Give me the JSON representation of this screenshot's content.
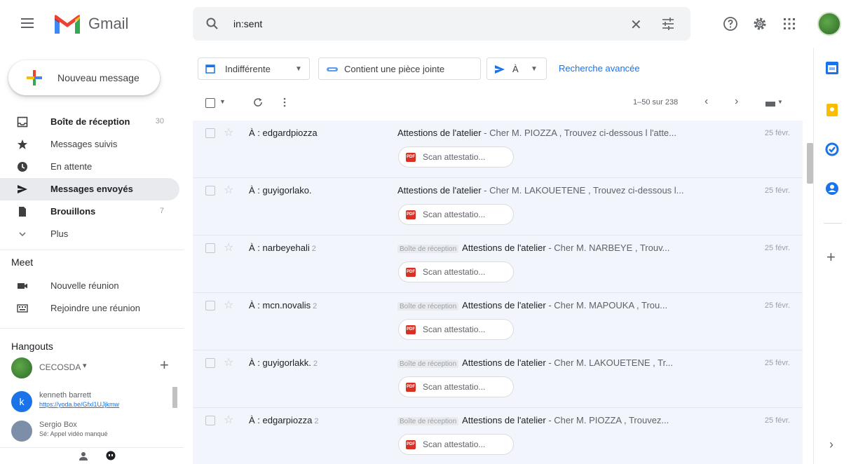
{
  "app": {
    "name": "Gmail"
  },
  "search": {
    "value": "in:sent"
  },
  "compose": {
    "label": "Nouveau message"
  },
  "nav": [
    {
      "label": "Boîte de réception",
      "count": "30",
      "bold": true
    },
    {
      "label": "Messages suivis",
      "count": "",
      "bold": false
    },
    {
      "label": "En attente",
      "count": "",
      "bold": false
    },
    {
      "label": "Messages envoyés",
      "count": "",
      "bold": true,
      "active": true
    },
    {
      "label": "Brouillons",
      "count": "7",
      "bold": true
    },
    {
      "label": "Plus",
      "count": "",
      "bold": false
    }
  ],
  "meet": {
    "title": "Meet",
    "new_meeting": "Nouvelle réunion",
    "join_meeting": "Rejoindre une réunion"
  },
  "hangouts": {
    "title": "Hangouts",
    "user": "CECOSDA",
    "contacts": [
      {
        "name": "kenneth barrett",
        "sub": "https://yoda.be/Gfxl1UJjkmw"
      },
      {
        "name": "Sergio Box",
        "sub": "Sé: Appel vidéo manqué"
      }
    ]
  },
  "filters": {
    "date": "Indifférente",
    "attachment": "Contient une pièce jointe",
    "to": "À",
    "advanced": "Recherche avancée"
  },
  "toolbar": {
    "pagination": "1–50 sur 238"
  },
  "emails": [
    {
      "sender": "À : edgardpiozza",
      "count": "",
      "label": "",
      "subject": "Attestions de l'atelier",
      "snippet": " - Cher M. PIOZZA , Trouvez ci-dessous l l'atte...",
      "date": "25 févr.",
      "attachment": "Scan attestatio..."
    },
    {
      "sender": "À : guyigorlako.",
      "count": "",
      "label": "",
      "subject": "Attestions de l'atelier",
      "snippet": " - Cher M. LAKOUETENE , Trouvez ci-dessous l...",
      "date": "25 févr.",
      "attachment": "Scan attestatio..."
    },
    {
      "sender": "À : narbeyehali",
      "count": "2",
      "label": "Boîte de réception",
      "subject": "Attestions de l'atelier",
      "snippet": " - Cher M. NARBEYE , Trouv...",
      "date": "25 févr.",
      "attachment": "Scan attestatio..."
    },
    {
      "sender": "À : mcn.novalis",
      "count": "2",
      "label": "Boîte de réception",
      "subject": "Attestions de l'atelier",
      "snippet": " - Cher M. MAPOUKA , Trou...",
      "date": "25 févr.",
      "attachment": "Scan attestatio..."
    },
    {
      "sender": "À : guyigorlakk.",
      "count": "2",
      "label": "Boîte de réception",
      "subject": "Attestions de l'atelier",
      "snippet": " - Cher M. LAKOUETENE , Tr...",
      "date": "25 févr.",
      "attachment": "Scan attestatio..."
    },
    {
      "sender": "À : edgarpiozza",
      "count": "2",
      "label": "Boîte de réception",
      "subject": "Attestions de l'atelier",
      "snippet": " - Cher M. PIOZZA , Trouvez...",
      "date": "25 févr.",
      "attachment": "Scan attestatio..."
    }
  ]
}
